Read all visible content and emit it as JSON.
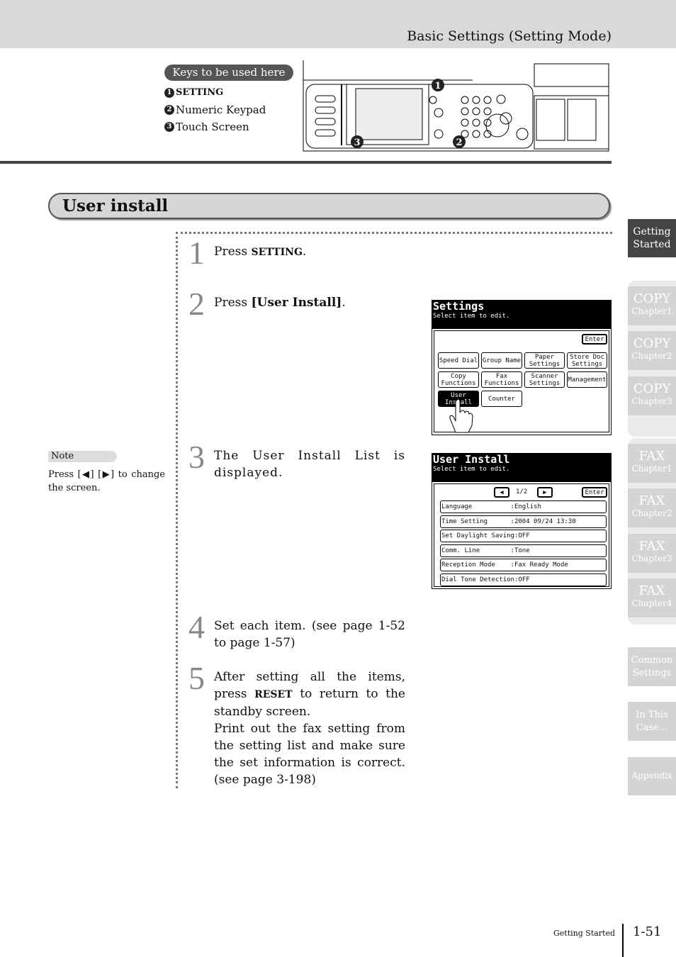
{
  "header": {
    "title": "Basic Settings (Setting Mode)"
  },
  "keys": {
    "label": "Keys to be used here",
    "items": [
      {
        "num": "1",
        "label": "SETTING"
      },
      {
        "num": "2",
        "label": "Numeric Keypad"
      },
      {
        "num": "3",
        "label": "Touch Screen"
      }
    ]
  },
  "panel": {
    "callouts": [
      "1",
      "2",
      "3"
    ]
  },
  "section": {
    "title": "User install"
  },
  "steps": [
    {
      "num": "1",
      "pre": "Press ",
      "key": "SETTING",
      "post": "."
    },
    {
      "num": "2",
      "pre": "Press ",
      "key": "[User Install]",
      "post": "."
    },
    {
      "num": "3",
      "text": "The User Install List is displayed."
    },
    {
      "num": "4",
      "text": "Set each item. (see page 1-52 to page 1-57)"
    },
    {
      "num": "5",
      "pre": "After setting all the items, press ",
      "key": "RESET",
      "post": " to return to the standby screen.",
      "extra": "Print out the fax setting from the setting list and make sure the set information is correct. (see page 3-198)"
    }
  ],
  "screen_settings": {
    "title": "Settings",
    "subtitle": "Select item to edit.",
    "enter": "Enter",
    "buttons": [
      "Speed Dial",
      "Group Name",
      "Paper Settings",
      "Store Doc Settings",
      "Copy Functions",
      "Fax Functions",
      "Scanner Settings",
      "Management",
      "User Install",
      "Counter"
    ]
  },
  "screen_user_install": {
    "title": "User Install",
    "subtitle": "Select item to edit.",
    "page": "1/2",
    "enter": "Enter",
    "rows": [
      "Language          :English",
      "Time Setting      :2004 09/24 13:30",
      "Set Daylight Saving:OFF",
      "Comm. Line        :Tone",
      "Reception Mode    :Fax Ready Mode",
      "Dial Tone Detection:OFF"
    ]
  },
  "note": {
    "label": "Note",
    "text": "Press [◀] [▶] to change the screen."
  },
  "side_tabs": [
    {
      "a": "Getting",
      "b": "Started",
      "active": true
    },
    {
      "a": "COPY",
      "b": "Chapter1"
    },
    {
      "a": "COPY",
      "b": "Chapter2"
    },
    {
      "a": "COPY",
      "b": "Chapter3"
    },
    {
      "a": "FAX",
      "b": "Chapter1"
    },
    {
      "a": "FAX",
      "b": "Chapter2"
    },
    {
      "a": "FAX",
      "b": "Chapter3"
    },
    {
      "a": "FAX",
      "b": "Chapter4"
    },
    {
      "a": "Common",
      "b": "Settings"
    },
    {
      "a": "In This",
      "b": "Case..."
    },
    {
      "a": "Appendix",
      "b": ""
    }
  ],
  "footer": {
    "label": "Getting Started",
    "page": "1-51"
  },
  "colors": {
    "active_tab": "#444444",
    "inactive_tab": "#d4d4d4",
    "header_bg": "#d9d9d9"
  }
}
